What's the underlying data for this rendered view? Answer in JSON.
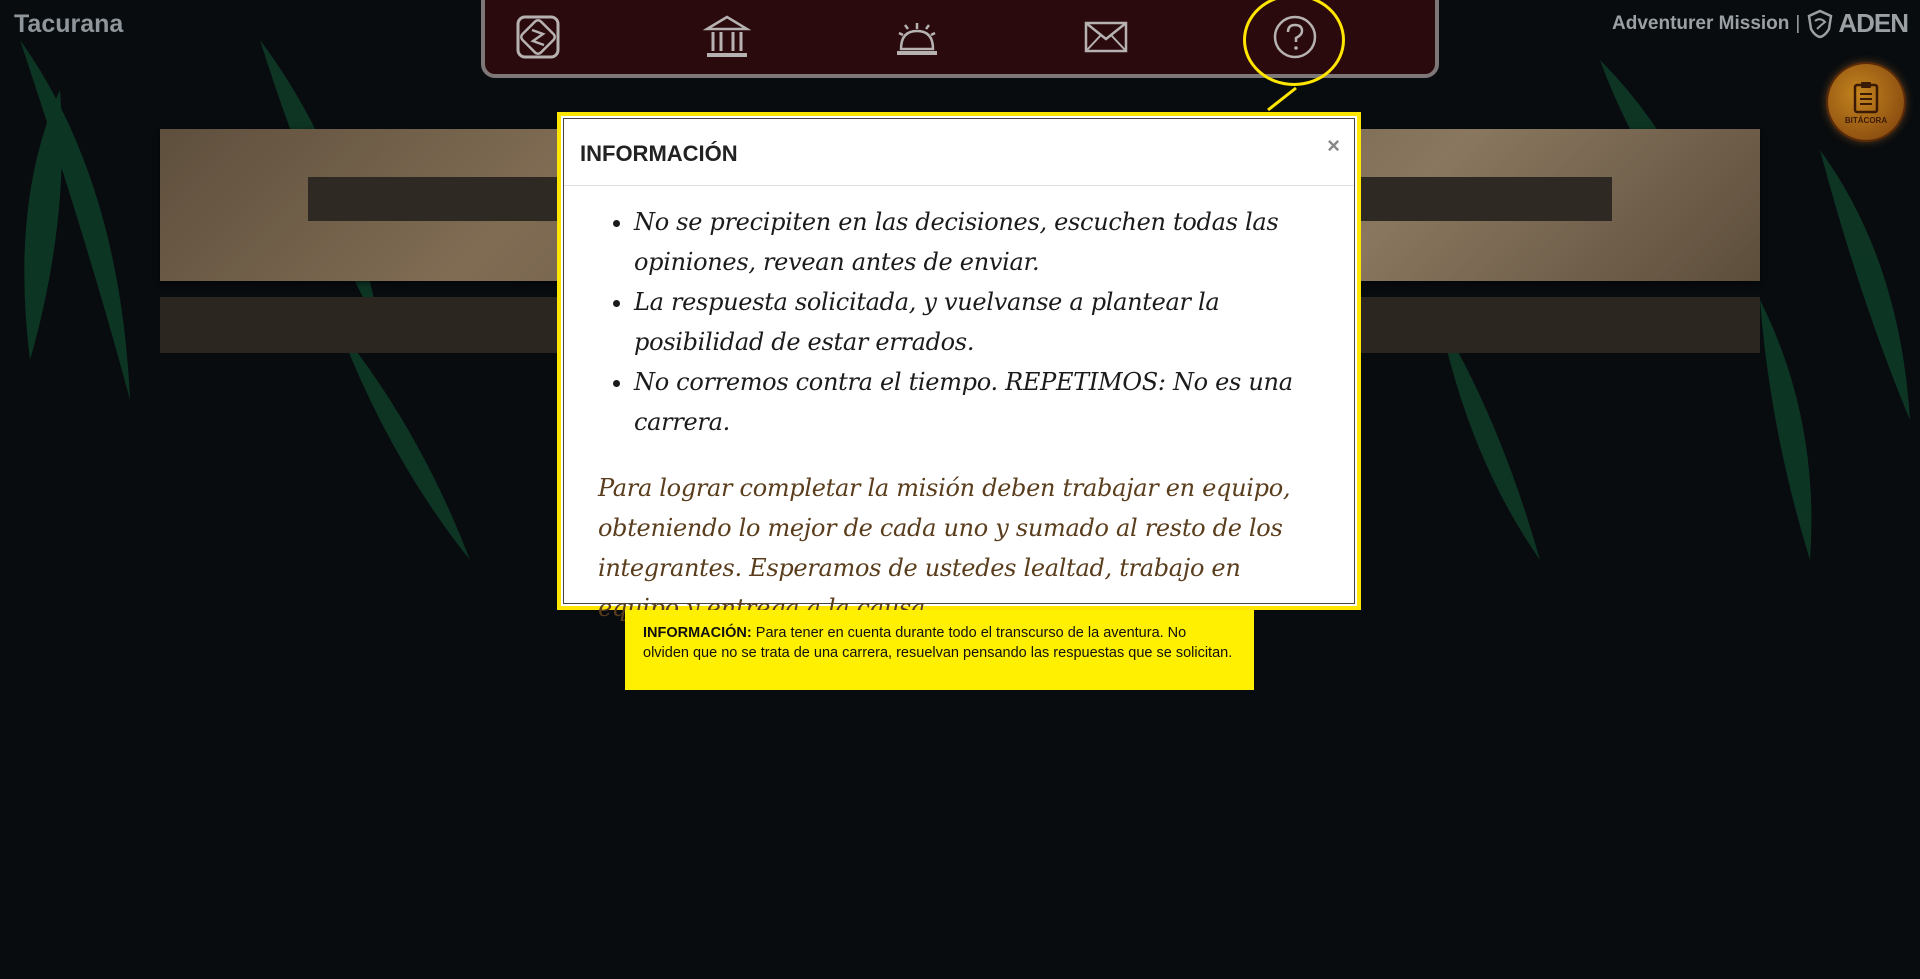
{
  "app": {
    "brand": "Tacurana",
    "mission_title": "Adventurer Mission",
    "separator": "|",
    "logo_text": "ADEN",
    "bitacora_label": "BITÁCORA"
  },
  "nav": {
    "items": [
      {
        "icon": "puzzle-dice-icon"
      },
      {
        "icon": "bank-icon"
      },
      {
        "icon": "reception-bell-icon"
      },
      {
        "icon": "envelope-icon"
      },
      {
        "icon": "question-icon"
      }
    ]
  },
  "modal": {
    "title": "INFORMACIÓN",
    "close_label": "×",
    "bullets": [
      "No se precipiten en las decisiones, escuchen todas las opiniones, revean antes de enviar.",
      "La respuesta solicitada, y vuelvanse a plantear la posibilidad de estar errados.",
      "No corremos contra el tiempo. REPETIMOS: No es una carrera."
    ],
    "closing": "Para lograr completar la misión deben trabajar en equipo, obteniendo lo mejor de cada uno y sumado al resto de los integrantes. Esperamos de ustedes lealtad, trabajo en equipo y entrega a la causa."
  },
  "tooltip": {
    "title": "INFORMACIÓN:",
    "text": "Para tener en cuenta durante todo el transcurso de la aventura. No olviden que no se trata de una carrera, resuelvan pensando las respuestas que se solicitan."
  },
  "colors": {
    "background": "#080c0f",
    "nav_bg": "#2a0a0d",
    "highlight": "#ffe600",
    "closing_text": "#5a3d1c"
  }
}
